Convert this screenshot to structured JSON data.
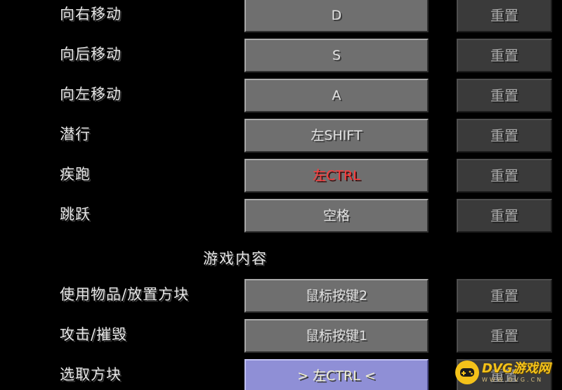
{
  "controls_top": [
    {
      "action": "向右移动",
      "key": "D",
      "reset": "重置",
      "state": "normal"
    },
    {
      "action": "向后移动",
      "key": "S",
      "reset": "重置",
      "state": "normal"
    },
    {
      "action": "向左移动",
      "key": "A",
      "reset": "重置",
      "state": "normal"
    },
    {
      "action": "潜行",
      "key": "左SHIFT",
      "reset": "重置",
      "state": "normal"
    },
    {
      "action": "疾跑",
      "key": "左CTRL",
      "reset": "重置",
      "state": "conflict"
    },
    {
      "action": "跳跃",
      "key": "空格",
      "reset": "重置",
      "state": "normal"
    }
  ],
  "section": {
    "title": "游戏内容"
  },
  "controls_bottom": [
    {
      "action": "使用物品/放置方块",
      "key": "鼠标按键2",
      "reset": "重置",
      "state": "normal"
    },
    {
      "action": "攻击/摧毁",
      "key": "鼠标按键1",
      "reset": "重置",
      "state": "normal"
    },
    {
      "action": "选取方块",
      "key": "> 左CTRL <",
      "reset": "重置",
      "state": "selected"
    }
  ],
  "watermark": {
    "brand": "DVG游戏网",
    "url": "WWW.DVG.CN",
    "icon": "gamepad-icon"
  },
  "colors": {
    "background": "#000000",
    "conflict_text": "#ff3a3a",
    "selected_button": "#8f8fd6",
    "watermark": "#f4c21a"
  }
}
